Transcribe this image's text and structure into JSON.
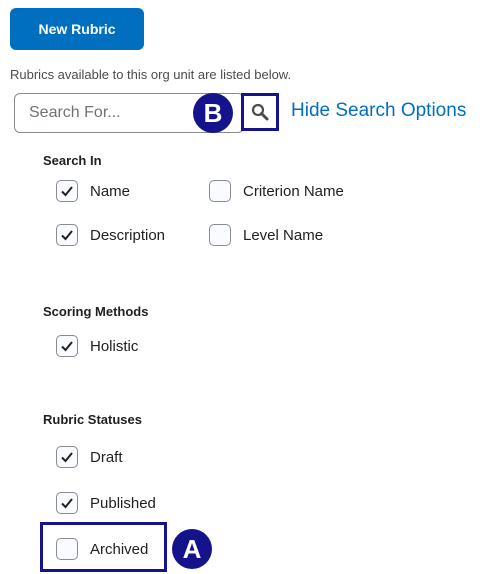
{
  "new_rubric_label": "New Rubric",
  "intro": "Rubrics available to this org unit are listed below.",
  "search": {
    "placeholder": "Search For...",
    "hide_options_label": "Hide Search Options"
  },
  "callouts": {
    "a": "A",
    "b": "B"
  },
  "search_in": {
    "label": "Search In",
    "options": [
      {
        "label": "Name",
        "checked": true
      },
      {
        "label": "Criterion Name",
        "checked": false
      },
      {
        "label": "Description",
        "checked": true
      },
      {
        "label": "Level Name",
        "checked": false
      }
    ]
  },
  "scoring_methods": {
    "label": "Scoring Methods",
    "options": [
      {
        "label": "Holistic",
        "checked": true
      }
    ]
  },
  "rubric_statuses": {
    "label": "Rubric Statuses",
    "options": [
      {
        "label": "Draft",
        "checked": true
      },
      {
        "label": "Published",
        "checked": true
      },
      {
        "label": "Archived",
        "checked": false
      }
    ]
  },
  "colors": {
    "primary": "#006fbf",
    "callout": "#15138b",
    "text": "#202122"
  },
  "icons": {
    "search": "search-icon",
    "check": "checkmark-icon"
  }
}
